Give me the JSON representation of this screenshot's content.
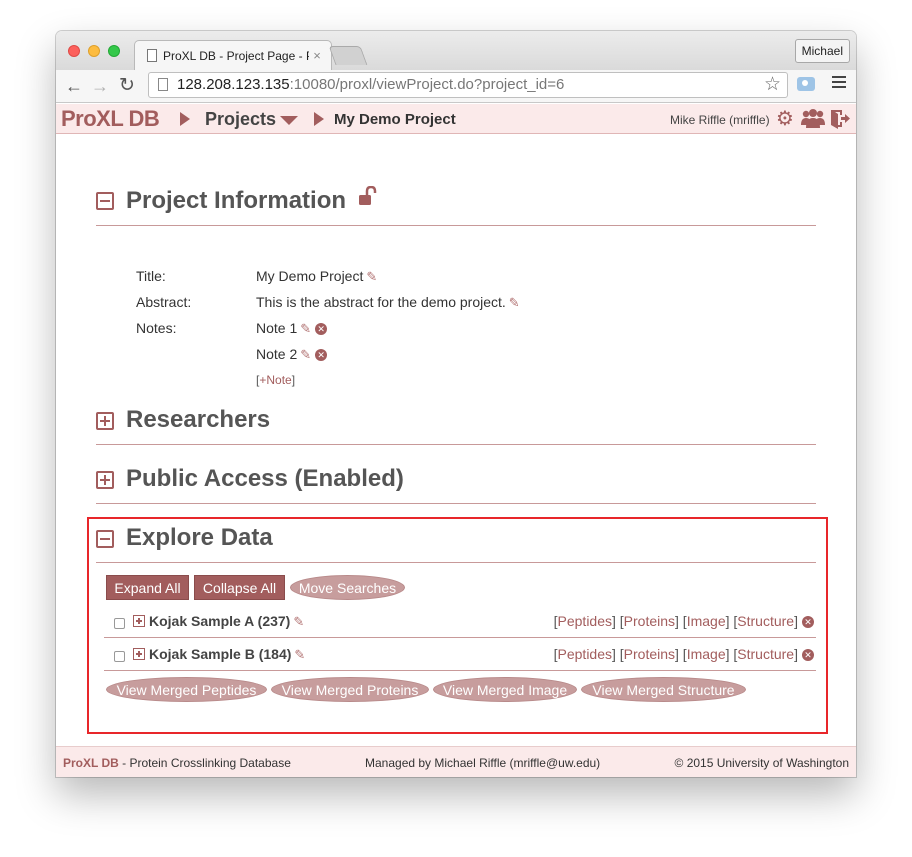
{
  "browser": {
    "tab_title": "ProXL DB - Project Page - P",
    "tab_close": "×",
    "profile_name": "Michael",
    "url_host": "128.208.123.135",
    "url_rest": ":10080/proxl/viewProject.do?project_id=6",
    "icons": [
      "back-icon",
      "forward-icon",
      "reload-icon",
      "star-icon",
      "camera-icon",
      "menu-icon"
    ]
  },
  "header": {
    "logo": "ProXL DB",
    "projects_label": "Projects",
    "current_project": "My Demo Project",
    "user": "Mike Riffle (mriffle)",
    "accent_color": "#a25d5d"
  },
  "project_info": {
    "title": "Project Information",
    "rows": [
      {
        "label": "Title:",
        "value": "My Demo Project"
      },
      {
        "label": "Abstract:",
        "value": "This is the abstract for the demo project."
      },
      {
        "label": "Notes:",
        "value": "Note 1"
      }
    ],
    "note2": "Note 2",
    "add_note_open": "[",
    "add_note_link": "+Note",
    "add_note_close": "]"
  },
  "researchers": {
    "title": "Researchers"
  },
  "public_access": {
    "title": "Public Access (Enabled)"
  },
  "explore": {
    "title": "Explore Data",
    "buttons": {
      "expand_all": "Expand All",
      "collapse_all": "Collapse All",
      "move_searches": "Move Searches"
    },
    "searches": [
      {
        "name": "Kojak Sample A (237)"
      },
      {
        "name": "Kojak Sample B (184)"
      }
    ],
    "row_links": {
      "peptides": "Peptides",
      "proteins": "Proteins",
      "image": "Image",
      "structure": "Structure"
    },
    "merged_buttons": {
      "peptides": "View Merged Peptides",
      "proteins": "View Merged Proteins",
      "image": "View Merged Image",
      "structure": "View Merged Structure"
    },
    "highlight_color": "#e8262a"
  },
  "footer": {
    "brand": "ProXL DB",
    "tagline": " - Protein Crosslinking Database",
    "managed": "Managed by Michael Riffle (mriffle@uw.edu)",
    "copyright": "© 2015 University of Washington"
  }
}
